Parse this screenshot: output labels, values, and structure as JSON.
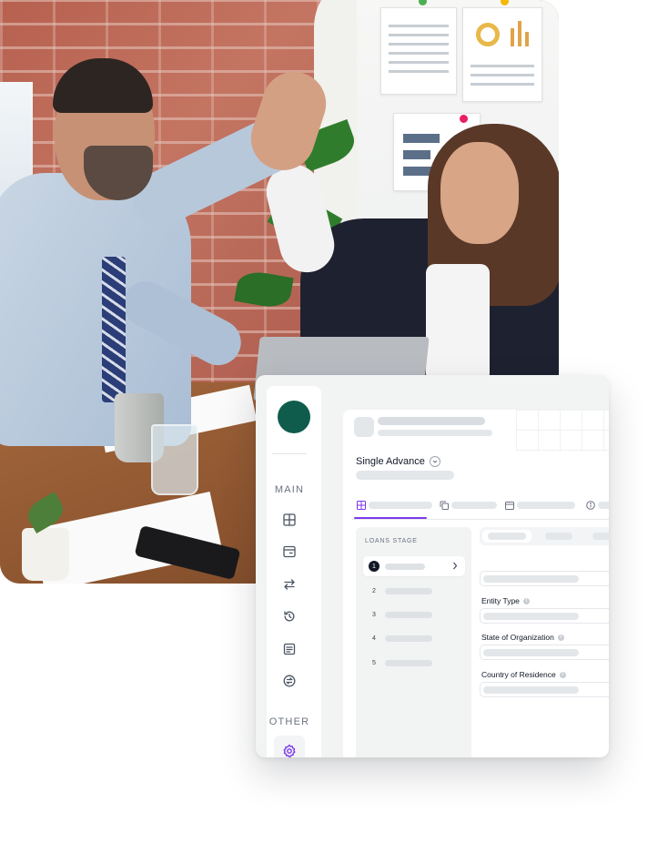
{
  "sidebar": {
    "main_label": "MAIN",
    "other_label": "OTHER",
    "icons": [
      "grid-icon",
      "card-icon",
      "transfer-icon",
      "history-icon",
      "document-icon",
      "exchange-icon",
      "settings-icon"
    ]
  },
  "page": {
    "title": "Single Advance"
  },
  "stages": {
    "title": "LOANS STAGE",
    "numbers": [
      "1",
      "2",
      "3",
      "4",
      "5"
    ]
  },
  "form": {
    "entity_type_label": "Entity Type",
    "state_label": "State of Organization",
    "country_label": "Country of Residence",
    "info_glyph": "i"
  },
  "colors": {
    "brand": "#0f5c4c",
    "accent": "#7c3aed"
  }
}
